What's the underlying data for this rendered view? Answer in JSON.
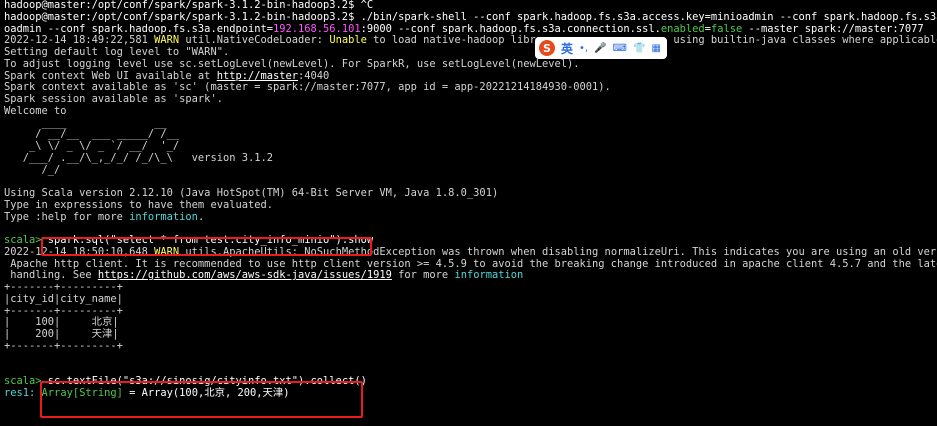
{
  "colors": {
    "background": "#000000",
    "text": "#d4d4d4",
    "prompt_green": "#4ec94e",
    "link_cyan": "#4fd6d6",
    "warn_yellow": "#ffff55",
    "highlight_box": "#e81c1c",
    "ime_logo": "#e8491d"
  },
  "lines": [
    [
      {
        "t": "hadoop@master:/opt/conf/spark/spark-3.1.2-bin-hadoop3.2$ ^C",
        "c": "white"
      }
    ],
    [
      {
        "t": "hadoop@master:/opt/conf/spark/spark-3.1.2-bin-hadoop3.2$ ./bin/spark-shell --conf spark.hadoop.fs.s3a.access.key=minioadmin --conf spark.hadoop.fs.s3a.secr",
        "c": "white"
      }
    ],
    [
      {
        "t": "oadmin --conf spark.hadoop.fs.s3a.endpoint=",
        "c": "white"
      },
      {
        "t": "192.168.56.101",
        "c": "magenta"
      },
      {
        "t": ":9000 --conf spark.hadoop.fs.s3a.connection.ssl.",
        "c": "white"
      },
      {
        "t": "enabled",
        "c": "green"
      },
      {
        "t": "=",
        "c": "white"
      },
      {
        "t": "false",
        "c": "green"
      },
      {
        "t": " --master spark://master:7077",
        "c": "white"
      }
    ],
    [
      {
        "t": "2022-12-14 18:49:22,581 ",
        "c": "gray"
      },
      {
        "t": "WARN",
        "c": "yellow"
      },
      {
        "t": " util.NativeCodeLoader: ",
        "c": "gray"
      },
      {
        "t": "Unable",
        "c": "yellow"
      },
      {
        "t": " to load native-hadoop library                   using builtin-java classes where applicable",
        "c": "gray"
      }
    ],
    [
      {
        "t": "Setting default log level to \"WARN\".",
        "c": "gray"
      }
    ],
    [
      {
        "t": "To adjust logging level use sc.setLogLevel(newLevel). For SparkR, use setLogLevel(newLevel).",
        "c": "gray"
      }
    ],
    [
      {
        "t": "Spark context Web UI available at ",
        "c": "gray"
      },
      {
        "t": "http://master",
        "c": "white",
        "u": true
      },
      {
        "t": ":4040",
        "c": "gray"
      }
    ],
    [
      {
        "t": "Spark context available as 'sc' (master = spark://master:7077, app id = app-20221214184930-0001).",
        "c": "gray"
      }
    ],
    [
      {
        "t": "Spark session available as 'spark'.",
        "c": "gray"
      }
    ],
    [
      {
        "t": "Welcome to",
        "c": "gray"
      }
    ],
    [
      {
        "t": "      ____              __",
        "c": "gray"
      }
    ],
    [
      {
        "t": "     / __/__  ___ _____/ /__",
        "c": "gray"
      }
    ],
    [
      {
        "t": "    _\\ \\/ _ \\/ _ `/ __/  '_/",
        "c": "gray"
      }
    ],
    [
      {
        "t": "   /___/ .__/\\_,_/_/ /_/\\_\\   version 3.1.2",
        "c": "gray"
      }
    ],
    [
      {
        "t": "      /_/",
        "c": "gray"
      }
    ],
    [
      {
        "t": "",
        "c": "gray"
      }
    ],
    [
      {
        "t": "Using Scala version 2.12.10 (Java HotSpot(TM) 64-Bit Server VM, Java 1.8.0_301)",
        "c": "gray"
      }
    ],
    [
      {
        "t": "Type in expressions to have them evaluated.",
        "c": "gray"
      }
    ],
    [
      {
        "t": "Type :help for more ",
        "c": "gray"
      },
      {
        "t": "information",
        "c": "cyan"
      },
      {
        "t": ".",
        "c": "gray"
      }
    ],
    [
      {
        "t": "",
        "c": "gray"
      }
    ],
    [
      {
        "t": "scala> ",
        "c": "green"
      },
      {
        "t": "spark.sql(\"select * from test.city_info_minio\").show",
        "c": "white"
      }
    ],
    [
      {
        "t": "2022-12-14 18:50:10,648 ",
        "c": "gray"
      },
      {
        "t": "WARN",
        "c": "yellow"
      },
      {
        "t": " utils.ApacheUtils: NoSuchMethodException was thrown when disabling normalizeUri. This indicates you are using an old version (",
        "c": "gray"
      }
    ],
    [
      {
        "t": " Apache http client. It is recommended to use http client version >= 4.5.9 to avoid the breaking change introduced in apache client 4.5.7 and the latency i",
        "c": "gray"
      }
    ],
    [
      {
        "t": " handling. See ",
        "c": "gray"
      },
      {
        "t": "https://github.com/aws/aws-sdk-java/issues/1919",
        "c": "white",
        "u": true
      },
      {
        "t": " for more ",
        "c": "gray"
      },
      {
        "t": "information",
        "c": "cyan"
      }
    ],
    [
      {
        "t": "+-------+---------+",
        "c": "gray"
      }
    ],
    [
      {
        "t": "|city_id|city_name|",
        "c": "gray"
      }
    ],
    [
      {
        "t": "+-------+---------+",
        "c": "gray"
      }
    ],
    [
      {
        "t": "|    100|     北京|",
        "c": "gray"
      }
    ],
    [
      {
        "t": "|    200|     天津|",
        "c": "gray"
      }
    ],
    [
      {
        "t": "+-------+---------+",
        "c": "gray"
      }
    ],
    [
      {
        "t": "",
        "c": "gray"
      }
    ],
    [
      {
        "t": "",
        "c": "gray"
      }
    ],
    [
      {
        "t": "scala> ",
        "c": "green"
      },
      {
        "t": "sc.textFile(\"s3a://sinosig/cityinfo.txt\").collect()",
        "c": "white"
      }
    ],
    [
      {
        "t": "res1: ",
        "c": "cyan"
      },
      {
        "t": "Array[String]",
        "c": "green"
      },
      {
        "t": " = Array(100,北京, 200,天津)",
        "c": "white"
      }
    ],
    [
      {
        "t": "",
        "c": "gray"
      }
    ]
  ],
  "ime": {
    "logo": "S",
    "mode": "英",
    "icons": [
      "punctuation-icon",
      "microphone-icon",
      "keyboard-icon",
      "skin-icon",
      "toolbox-icon"
    ],
    "glyphs": [
      "•,",
      "🎤",
      "⌨",
      "👕",
      "▦"
    ]
  }
}
